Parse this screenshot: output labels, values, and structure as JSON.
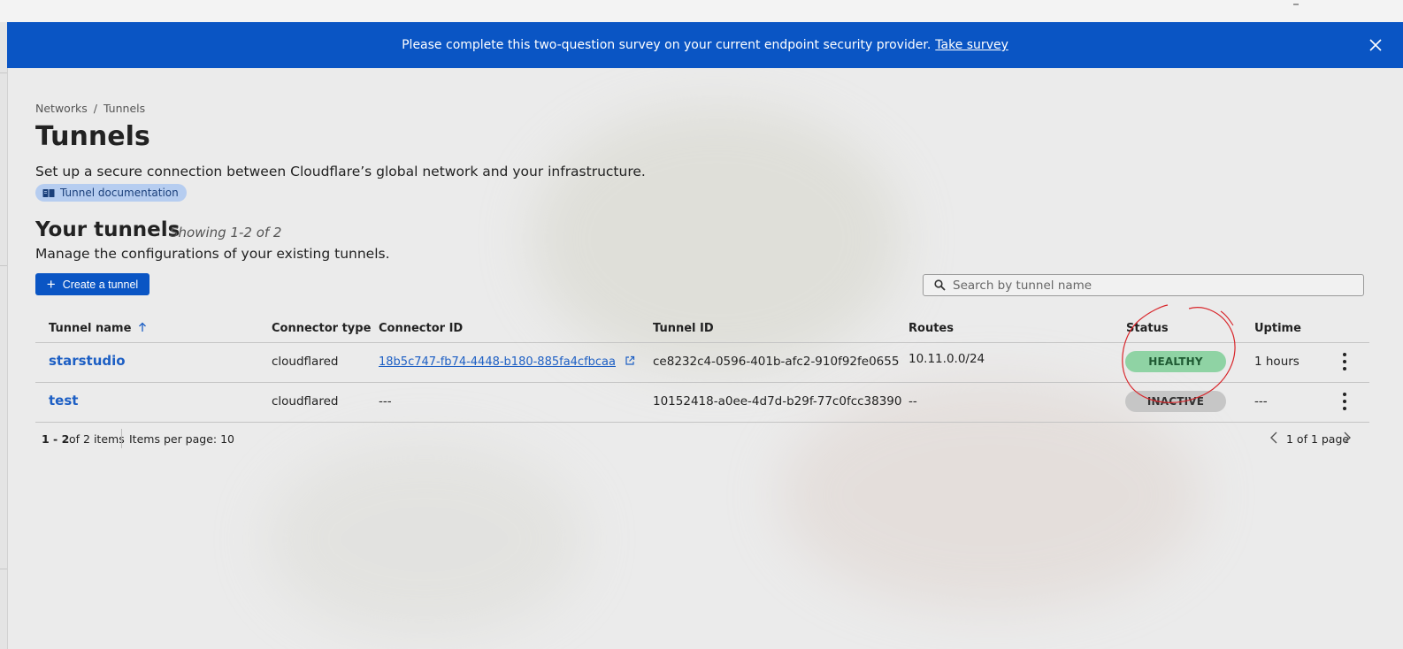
{
  "banner": {
    "message": "Please complete this two-question survey on your current endpoint security provider.",
    "link_label": "Take survey"
  },
  "breadcrumb": {
    "items": [
      "Networks",
      "Tunnels"
    ],
    "separator": "/"
  },
  "page": {
    "title": "Tunnels",
    "description": "Set up a secure connection between Cloudflare’s global network and your infrastructure.",
    "doc_link": "Tunnel documentation"
  },
  "tunnels_section": {
    "title": "Your tunnels",
    "showing": "Showing 1-2 of 2",
    "description": "Manage the configurations of your existing tunnels.",
    "create_button": "Create a tunnel",
    "search_placeholder": "Search by tunnel name"
  },
  "table": {
    "columns": {
      "name": "Tunnel name",
      "connector_type": "Connector type",
      "connector_id": "Connector ID",
      "tunnel_id": "Tunnel ID",
      "routes": "Routes",
      "status": "Status",
      "uptime": "Uptime"
    },
    "sort_column": "Tunnel name",
    "sort_direction": "ascending",
    "rows": [
      {
        "name": "starstudio",
        "connector_type": "cloudflared",
        "connector_id": "18b5c747-fb74-4448-b180-885fa4cfbcaa",
        "tunnel_id": "ce8232c4-0596-401b-afc2-910f92fe0655",
        "routes": "10.11.0.0/24",
        "status": "HEALTHY",
        "uptime": "1 hours"
      },
      {
        "name": "test",
        "connector_type": "cloudflared",
        "connector_id": "---",
        "tunnel_id": "10152418-a0ee-4d7d-b29f-77c0fcc38390",
        "routes": "--",
        "status": "INACTIVE",
        "uptime": "---"
      }
    ]
  },
  "pagination": {
    "range": "1 - 2",
    "total": "of 2 items",
    "per_page": "Items per page: 10",
    "page_info": "1 of 1 page"
  },
  "colors": {
    "primary": "#0a55c4",
    "link": "#1d5fc4",
    "healthy_bg": "#8fd3a4",
    "healthy_text": "#1f5a33",
    "inactive_bg": "#c6c6c6",
    "inactive_text": "#333333",
    "annotation": "#d8262b"
  }
}
